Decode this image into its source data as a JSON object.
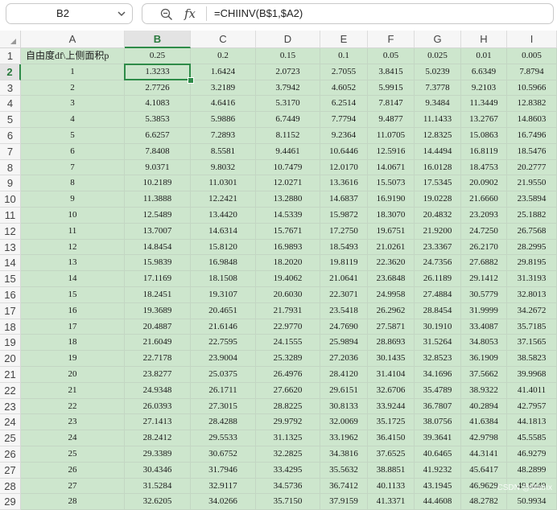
{
  "name_box": {
    "value": "B2"
  },
  "formula_bar": {
    "fx_label": "fx",
    "formula": "=CHIINV(B$1,$A2)"
  },
  "columns": [
    "A",
    "B",
    "C",
    "D",
    "E",
    "F",
    "G",
    "H",
    "I"
  ],
  "active_cell": {
    "column": "B",
    "row": "2"
  },
  "colors": {
    "cell_fill": "#cde6cd",
    "selection": "#2e8b48",
    "header_bg": "#f6f6f6"
  },
  "rows": [
    {
      "row": "1",
      "cells": [
        "自由度df\\上侧面积p",
        "0.25",
        "0.2",
        "0.15",
        "0.1",
        "0.05",
        "0.025",
        "0.01",
        "0.005"
      ]
    },
    {
      "row": "2",
      "cells": [
        "1",
        "1.3233",
        "1.6424",
        "2.0723",
        "2.7055",
        "3.8415",
        "5.0239",
        "6.6349",
        "7.8794"
      ]
    },
    {
      "row": "3",
      "cells": [
        "2",
        "2.7726",
        "3.2189",
        "3.7942",
        "4.6052",
        "5.9915",
        "7.3778",
        "9.2103",
        "10.5966"
      ]
    },
    {
      "row": "4",
      "cells": [
        "3",
        "4.1083",
        "4.6416",
        "5.3170",
        "6.2514",
        "7.8147",
        "9.3484",
        "11.3449",
        "12.8382"
      ]
    },
    {
      "row": "5",
      "cells": [
        "4",
        "5.3853",
        "5.9886",
        "6.7449",
        "7.7794",
        "9.4877",
        "11.1433",
        "13.2767",
        "14.8603"
      ]
    },
    {
      "row": "6",
      "cells": [
        "5",
        "6.6257",
        "7.2893",
        "8.1152",
        "9.2364",
        "11.0705",
        "12.8325",
        "15.0863",
        "16.7496"
      ]
    },
    {
      "row": "7",
      "cells": [
        "6",
        "7.8408",
        "8.5581",
        "9.4461",
        "10.6446",
        "12.5916",
        "14.4494",
        "16.8119",
        "18.5476"
      ]
    },
    {
      "row": "8",
      "cells": [
        "7",
        "9.0371",
        "9.8032",
        "10.7479",
        "12.0170",
        "14.0671",
        "16.0128",
        "18.4753",
        "20.2777"
      ]
    },
    {
      "row": "9",
      "cells": [
        "8",
        "10.2189",
        "11.0301",
        "12.0271",
        "13.3616",
        "15.5073",
        "17.5345",
        "20.0902",
        "21.9550"
      ]
    },
    {
      "row": "10",
      "cells": [
        "9",
        "11.3888",
        "12.2421",
        "13.2880",
        "14.6837",
        "16.9190",
        "19.0228",
        "21.6660",
        "23.5894"
      ]
    },
    {
      "row": "11",
      "cells": [
        "10",
        "12.5489",
        "13.4420",
        "14.5339",
        "15.9872",
        "18.3070",
        "20.4832",
        "23.2093",
        "25.1882"
      ]
    },
    {
      "row": "12",
      "cells": [
        "11",
        "13.7007",
        "14.6314",
        "15.7671",
        "17.2750",
        "19.6751",
        "21.9200",
        "24.7250",
        "26.7568"
      ]
    },
    {
      "row": "13",
      "cells": [
        "12",
        "14.8454",
        "15.8120",
        "16.9893",
        "18.5493",
        "21.0261",
        "23.3367",
        "26.2170",
        "28.2995"
      ]
    },
    {
      "row": "14",
      "cells": [
        "13",
        "15.9839",
        "16.9848",
        "18.2020",
        "19.8119",
        "22.3620",
        "24.7356",
        "27.6882",
        "29.8195"
      ]
    },
    {
      "row": "15",
      "cells": [
        "14",
        "17.1169",
        "18.1508",
        "19.4062",
        "21.0641",
        "23.6848",
        "26.1189",
        "29.1412",
        "31.3193"
      ]
    },
    {
      "row": "16",
      "cells": [
        "15",
        "18.2451",
        "19.3107",
        "20.6030",
        "22.3071",
        "24.9958",
        "27.4884",
        "30.5779",
        "32.8013"
      ]
    },
    {
      "row": "17",
      "cells": [
        "16",
        "19.3689",
        "20.4651",
        "21.7931",
        "23.5418",
        "26.2962",
        "28.8454",
        "31.9999",
        "34.2672"
      ]
    },
    {
      "row": "18",
      "cells": [
        "17",
        "20.4887",
        "21.6146",
        "22.9770",
        "24.7690",
        "27.5871",
        "30.1910",
        "33.4087",
        "35.7185"
      ]
    },
    {
      "row": "19",
      "cells": [
        "18",
        "21.6049",
        "22.7595",
        "24.1555",
        "25.9894",
        "28.8693",
        "31.5264",
        "34.8053",
        "37.1565"
      ]
    },
    {
      "row": "20",
      "cells": [
        "19",
        "22.7178",
        "23.9004",
        "25.3289",
        "27.2036",
        "30.1435",
        "32.8523",
        "36.1909",
        "38.5823"
      ]
    },
    {
      "row": "21",
      "cells": [
        "20",
        "23.8277",
        "25.0375",
        "26.4976",
        "28.4120",
        "31.4104",
        "34.1696",
        "37.5662",
        "39.9968"
      ]
    },
    {
      "row": "22",
      "cells": [
        "21",
        "24.9348",
        "26.1711",
        "27.6620",
        "29.6151",
        "32.6706",
        "35.4789",
        "38.9322",
        "41.4011"
      ]
    },
    {
      "row": "23",
      "cells": [
        "22",
        "26.0393",
        "27.3015",
        "28.8225",
        "30.8133",
        "33.9244",
        "36.7807",
        "40.2894",
        "42.7957"
      ]
    },
    {
      "row": "24",
      "cells": [
        "23",
        "27.1413",
        "28.4288",
        "29.9792",
        "32.0069",
        "35.1725",
        "38.0756",
        "41.6384",
        "44.1813"
      ]
    },
    {
      "row": "25",
      "cells": [
        "24",
        "28.2412",
        "29.5533",
        "31.1325",
        "33.1962",
        "36.4150",
        "39.3641",
        "42.9798",
        "45.5585"
      ]
    },
    {
      "row": "26",
      "cells": [
        "25",
        "29.3389",
        "30.6752",
        "32.2825",
        "34.3816",
        "37.6525",
        "40.6465",
        "44.3141",
        "46.9279"
      ]
    },
    {
      "row": "27",
      "cells": [
        "26",
        "30.4346",
        "31.7946",
        "33.4295",
        "35.5632",
        "38.8851",
        "41.9232",
        "45.6417",
        "48.2899"
      ]
    },
    {
      "row": "28",
      "cells": [
        "27",
        "31.5284",
        "32.9117",
        "34.5736",
        "36.7412",
        "40.1133",
        "43.1945",
        "46.9629",
        "49.6449"
      ]
    },
    {
      "row": "29",
      "cells": [
        "28",
        "32.6205",
        "34.0266",
        "35.7150",
        "37.9159",
        "41.3371",
        "44.4608",
        "48.2782",
        "50.9934"
      ]
    }
  ],
  "watermark": "CSDN @Matrix"
}
